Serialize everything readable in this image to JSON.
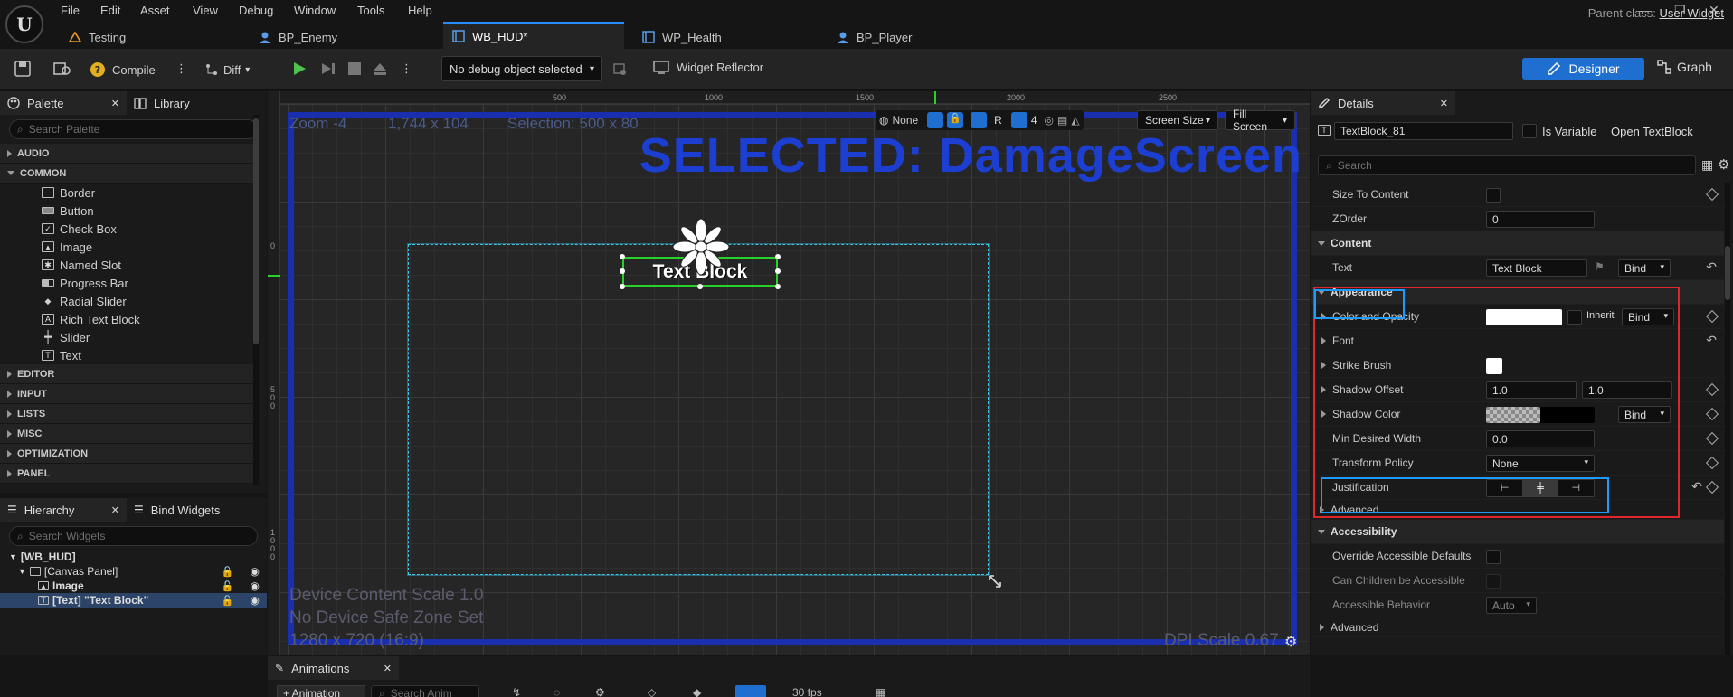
{
  "menu": {
    "logo": "U",
    "items": [
      "File",
      "Edit",
      "Asset",
      "View",
      "Debug",
      "Window",
      "Tools",
      "Help"
    ]
  },
  "tabs": [
    {
      "label": "Testing",
      "icon": "map-icon"
    },
    {
      "label": "BP_Enemy",
      "icon": "blueprint-icon"
    },
    {
      "label": "WB_HUD*",
      "icon": "widget-blueprint-icon"
    },
    {
      "label": "WP_Health",
      "icon": "widget-blueprint-icon"
    },
    {
      "label": "BP_Player",
      "icon": "blueprint-icon"
    }
  ],
  "parent_class": {
    "label": "Parent class:",
    "value": "User Widget"
  },
  "toolbar": {
    "compile": "Compile",
    "diff": "Diff",
    "debug_dropdown": "No debug object selected",
    "widget_reflector": "Widget Reflector",
    "designer": "Designer",
    "graph": "Graph"
  },
  "palette": {
    "tab": "Palette",
    "library_tab": "Library",
    "search_placeholder": "Search Palette",
    "categories_top": [
      "AUDIO",
      "COMMON"
    ],
    "common_items": [
      {
        "label": "Border",
        "icon": "border-icon"
      },
      {
        "label": "Button",
        "icon": "button-icon"
      },
      {
        "label": "Check Box",
        "icon": "checkbox-icon"
      },
      {
        "label": "Image",
        "icon": "image-icon"
      },
      {
        "label": "Named Slot",
        "icon": "named-slot-icon"
      },
      {
        "label": "Progress Bar",
        "icon": "progress-bar-icon"
      },
      {
        "label": "Radial Slider",
        "icon": "radial-slider-icon"
      },
      {
        "label": "Rich Text Block",
        "icon": "rich-text-icon"
      },
      {
        "label": "Slider",
        "icon": "slider-icon"
      },
      {
        "label": "Text",
        "icon": "text-icon"
      }
    ],
    "categories_bottom": [
      "EDITOR",
      "INPUT",
      "LISTS",
      "MISC",
      "OPTIMIZATION",
      "PANEL"
    ]
  },
  "hierarchy": {
    "tab": "Hierarchy",
    "bind_tab": "Bind Widgets",
    "search_placeholder": "Search Widgets",
    "nodes": [
      "[WB_HUD]",
      "[Canvas Panel]",
      "Image",
      "[Text] \"Text Block\""
    ]
  },
  "viewport": {
    "zoom": "Zoom -4",
    "resolution": "1,744 x 104",
    "selection": "Selection: 500 x 80",
    "selected_title": "SELECTED: DamageScreen",
    "text_block": "Text Block",
    "device_scale": "Device Content Scale 1.0",
    "safe_zone": "No Device Safe Zone Set",
    "screen_res": "1280 x 720 (16:9)",
    "dpi": "DPI Scale 0.67",
    "ruler_top": [
      "500",
      "1000",
      "1500",
      "2000",
      "2500"
    ],
    "ruler_left": [
      "0",
      "500",
      "1000"
    ],
    "controls": {
      "none": "None",
      "r": "R",
      "grid_num": "4",
      "screen_size": "Screen Size",
      "fill_screen": "Fill Screen"
    }
  },
  "details": {
    "tab": "Details",
    "widget_name": "TextBlock_81",
    "is_variable": "Is Variable",
    "open_link": "Open TextBlock",
    "search_placeholder": "Search",
    "rows": {
      "size_to_content": "Size To Content",
      "zorder": "ZOrder",
      "zorder_value": "0",
      "content": "Content",
      "text": "Text",
      "text_value": "Text Block",
      "bind": "Bind",
      "appearance": "Appearance",
      "color_opacity": "Color and Opacity",
      "inherit": "Inherit",
      "font": "Font",
      "strike_brush": "Strike Brush",
      "shadow_offset": "Shadow Offset",
      "shadow_x": "1.0",
      "shadow_y": "1.0",
      "shadow_color": "Shadow Color",
      "min_width": "Min Desired Width",
      "min_width_value": "0.0",
      "transform_policy": "Transform Policy",
      "transform_value": "None",
      "justification": "Justification",
      "advanced": "Advanced",
      "accessibility": "Accessibility",
      "override_access": "Override Accessible Defaults",
      "children_access": "Can Children be Accessible",
      "access_behavior": "Accessible Behavior",
      "access_value": "Auto",
      "advanced2": "Advanced"
    }
  },
  "animations": {
    "tab": "Animations",
    "add_button": "+ Animation",
    "search_placeholder": "Search Anim",
    "fps": "30 fps"
  },
  "colors": {
    "accent_blue": "#1f6fd1",
    "selection_title": "#1c3fd1",
    "highlight_red": "#e0262a",
    "highlight_blue": "#1e9bff",
    "selection_green": "#2bd12b",
    "canvas_cyan": "#3cc8e8"
  }
}
